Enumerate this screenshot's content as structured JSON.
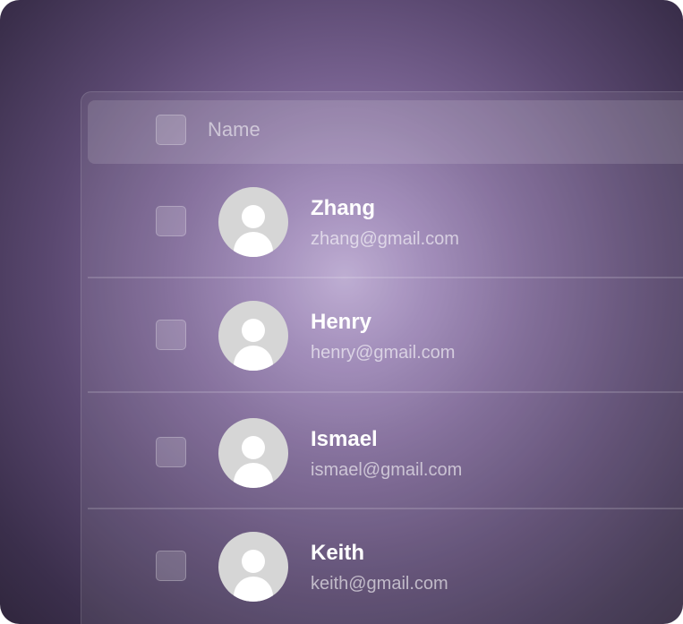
{
  "table": {
    "header": {
      "column_label": "Name"
    },
    "rows": [
      {
        "name": "Zhang",
        "email": "zhang@gmail.com"
      },
      {
        "name": "Henry",
        "email": "henry@gmail.com"
      },
      {
        "name": "Ismael",
        "email": "ismael@gmail.com"
      },
      {
        "name": "Keith",
        "email": "keith@gmail.com"
      }
    ]
  },
  "icons": {
    "avatar": "user-placeholder-avatar-icon",
    "checkbox": "checkbox-unchecked"
  },
  "colors": {
    "background_glow": "#b9a7cf",
    "background_dark": "#1c1622",
    "avatar_bg": "#d6d6d6",
    "name_text": "#ffffff"
  }
}
